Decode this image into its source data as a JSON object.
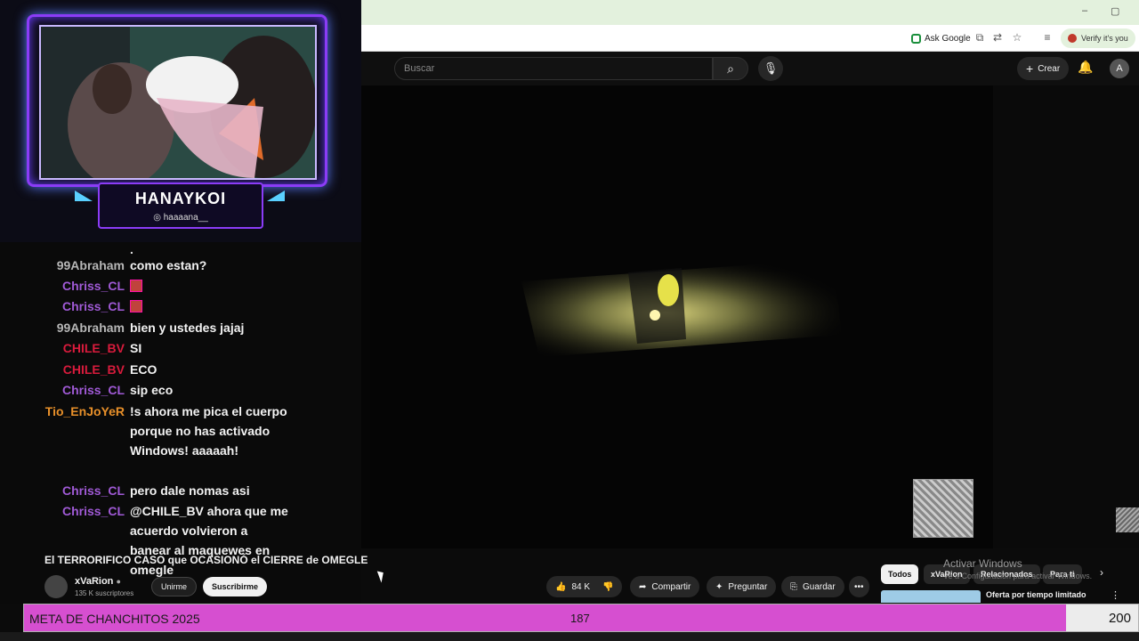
{
  "browser": {
    "minimize": "–",
    "restore": "▢",
    "ask_google": "Ask Google",
    "verify": "Verify it's you"
  },
  "youtube": {
    "search_placeholder": "Buscar",
    "create_label": "Crear",
    "avatar_letter": "A"
  },
  "overlay": {
    "streamer_name": "HANAYKOI",
    "instagram_handle": "haaaana__",
    "frame_color": "#8b3cf7"
  },
  "chat": {
    "messages": [
      {
        "user": "99Abraham",
        "color": "#b7b7b7",
        "text": "como estan?"
      },
      {
        "user": "Chriss_CL",
        "color": "#a05ad6",
        "text": "",
        "emote": true
      },
      {
        "user": "Chriss_CL",
        "color": "#a05ad6",
        "text": "",
        "emote": true
      },
      {
        "user": "99Abraham",
        "color": "#b7b7b7",
        "text": "bien y ustedes jajaj"
      },
      {
        "user": "CHILE_BV",
        "color": "#d81b3c",
        "text": "SI"
      },
      {
        "user": "CHILE_BV",
        "color": "#d81b3c",
        "text": "ECO"
      },
      {
        "user": "Chriss_CL",
        "color": "#a05ad6",
        "text": "sip eco"
      },
      {
        "user": "Tio_EnJoYeR",
        "color": "#e8902a",
        "text": "!s ahora me pica el cuerpo porque no has activado Windows! aaaaah!"
      },
      {
        "user": "Chriss_CL",
        "color": "#a05ad6",
        "text": "pero dale nomas asi"
      },
      {
        "user": "Chriss_CL",
        "color": "#a05ad6",
        "text": "@CHILE_BV ahora que me acuerdo volvieron a banear al maquewes en omegle"
      }
    ]
  },
  "video": {
    "title": "El TERRORIFICO CASO que OCASIONÓ el CIERRE de OMEGLE",
    "channel": "xVaRion",
    "subscribers": "135 K suscriptores",
    "join": "Unirme",
    "subscribe": "Suscribirme",
    "likes": "84 K",
    "share": "Compartir",
    "ask": "Preguntar",
    "save": "Guardar"
  },
  "chips": [
    "Todos",
    "xVaRion",
    "Relacionados",
    "Para ti"
  ],
  "windows_notice": {
    "title": "Activar Windows",
    "subtitle": "Ve a Configuración para activar Windows."
  },
  "offer": "Oferta por tiempo limitado",
  "goal": {
    "label": "META DE CHANCHITOS 2025",
    "current": 187,
    "target": 200,
    "fill_color": "#d64fd0"
  }
}
